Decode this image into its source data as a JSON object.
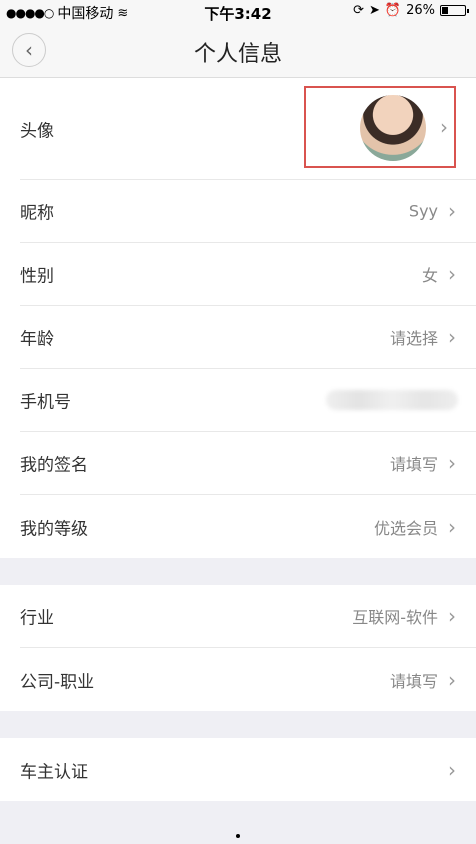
{
  "status_bar": {
    "carrier": "中国移动",
    "time": "下午3:42",
    "battery": "26%",
    "battery_level": 0.26
  },
  "nav": {
    "title": "个人信息"
  },
  "rows_group1": [
    {
      "label": "头像",
      "value": ""
    },
    {
      "label": "昵称",
      "value": "Syy"
    },
    {
      "label": "性别",
      "value": "女"
    },
    {
      "label": "年龄",
      "value": "请选择"
    },
    {
      "label": "手机号",
      "value": ""
    },
    {
      "label": "我的签名",
      "value": "请填写"
    },
    {
      "label": "我的等级",
      "value": "优选会员"
    }
  ],
  "rows_group2": [
    {
      "label": "行业",
      "value": "互联网-软件"
    },
    {
      "label": "公司-职业",
      "value": "请填写"
    }
  ],
  "rows_group3": [
    {
      "label": "车主认证",
      "value": ""
    }
  ],
  "icons": {
    "back": "back-chevron-icon",
    "chevron": "chevron-right-icon",
    "accent_box": "#d9534f"
  }
}
